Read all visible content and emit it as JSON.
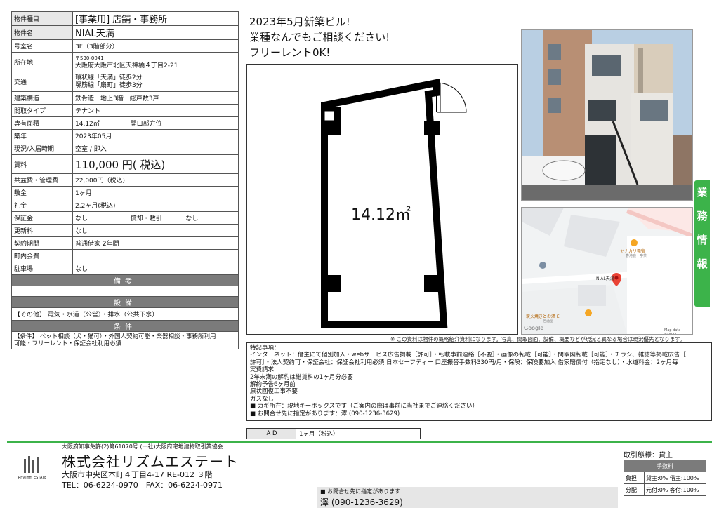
{
  "spec": {
    "property_type": {
      "label": "物件種目",
      "value": "[事業用] 店舗・事務所"
    },
    "property_name": {
      "label": "物件名",
      "value": "NIAL天満"
    },
    "room": {
      "label": "号室名",
      "value": "3F（3階部分）"
    },
    "location": {
      "label": "所在地",
      "postal": "〒530-0041",
      "value": "大阪府大阪市北区天神橋４丁目2-21"
    },
    "transport": {
      "label": "交通",
      "line1": "環状線「天満」徒歩2分",
      "line2": "堺筋線「扇町」徒歩3分"
    },
    "structure": {
      "label": "建築構造",
      "value": "鉄骨造　地上3階　総戸数3戸"
    },
    "layout": {
      "label": "間取タイプ",
      "value": "テナント"
    },
    "area": {
      "label": "専有面積",
      "value": "14.12㎡",
      "sub_label": "開口部方位",
      "sub_value": ""
    },
    "built": {
      "label": "築年",
      "value": "2023年05月"
    },
    "status": {
      "label": "現況/入居時期",
      "value": "空室 / 即入"
    },
    "rent": {
      "label": "賃料",
      "value": "110,000 円( 税込)"
    },
    "common_fee": {
      "label": "共益費・管理費",
      "value": "22,000円（税込)"
    },
    "deposit_month": {
      "label": "敷金",
      "value": "1ヶ月"
    },
    "key_money": {
      "label": "礼金",
      "value": "2.2ヶ月(税込)"
    },
    "guarantee": {
      "label": "保証金",
      "value": "なし",
      "sub_label": "償却・敷引",
      "sub_value": "なし"
    },
    "renewal": {
      "label": "更新料",
      "value": "なし"
    },
    "contract": {
      "label": "契約期間",
      "value": "普通借家 2年間"
    },
    "town_fee": {
      "label": "町内会費",
      "value": ""
    },
    "parking": {
      "label": "駐車場",
      "value": "なし"
    },
    "remarks_title": "備考",
    "facilities_title": "設備",
    "facilities_text": "【その他】 電気・水道（公営）・排水（公共下水）",
    "conditions_title": "条件",
    "conditions_text1": "【条件】 ペット相談（犬・猫可）・外国人契約可能・楽器相談・事務所利用",
    "conditions_text2": "可能・フリーレント・保証会社利用必須"
  },
  "headline": {
    "line1": "2023年5月新築ビル!",
    "line2": "業種なんでもご相談ください!",
    "line3": "フリーレント0K!"
  },
  "floorplan": {
    "area_label": "14.12㎡"
  },
  "map": {
    "place1": "ヤナカリ舞宿",
    "place1_sub": "香港鹿・亭茶",
    "place2": "NIAL天満",
    "place3": "炭火焼きとお酒 E",
    "place3_sub": "居酒屋",
    "google": "Google",
    "copyright": "Map data ©2024"
  },
  "side_tab": [
    "業",
    "務",
    "情",
    "報"
  ],
  "note": "※ この資料は物件の概略紹介資料になります。写真、間取図面、設備、概要などが現況と異なる場合は現況優先となります。",
  "remarks": {
    "title": "特記事項：",
    "lines": [
      "インターネット：借主にて個別加入・webサービス広告掲載［許可］・転載事前連絡［不要］・画像の転載［可能］・間取図転載［可能］・チラシ、雑誌等掲載広告［",
      "許可］・法人契約可・保証会社：保証会社利用必須 日本セーフティー 口座振替手数料330円/月・保険：保険要加入 借家賠償付（指定なし）・水道料金：2ヶ月毎",
      "実費請求",
      "2年未満の解約は総賃料の1ヶ月分必要",
      "解約予告6ヶ月前",
      "原状回復工事不要",
      "ガスなし",
      "■ カギ所在：現地キーボックスです（ご案内の際は事前に当社までご連絡ください）",
      "■ お問合せ先に指定があります：澤 (090-1236-3629)"
    ]
  },
  "ad": {
    "label": "A D",
    "value": "1ヶ月（税込）"
  },
  "company": {
    "license": "大阪府知事免許(2)第61070号 (一社)大阪府宅地建物取引業協会",
    "name": "株式会社リズムエステート",
    "address": "大阪市中央区本町４丁目4-17 RE-012 ３階",
    "tel": "TEL：06-6224-0970　FAX：06-6224-0971",
    "logo_text": "RhyThm ESTATE"
  },
  "fees": {
    "mode": "取引態様：貸主",
    "header": "手数料",
    "row1_label": "負担",
    "row1_value": "貸主:0% 借主:100%",
    "row2_label": "分配",
    "row2_value": "元付:0% 客付:100%"
  },
  "contact_bar": {
    "line1": "■ お問合せ先に指定があります",
    "line2": "澤 (090-1236-3629)"
  }
}
